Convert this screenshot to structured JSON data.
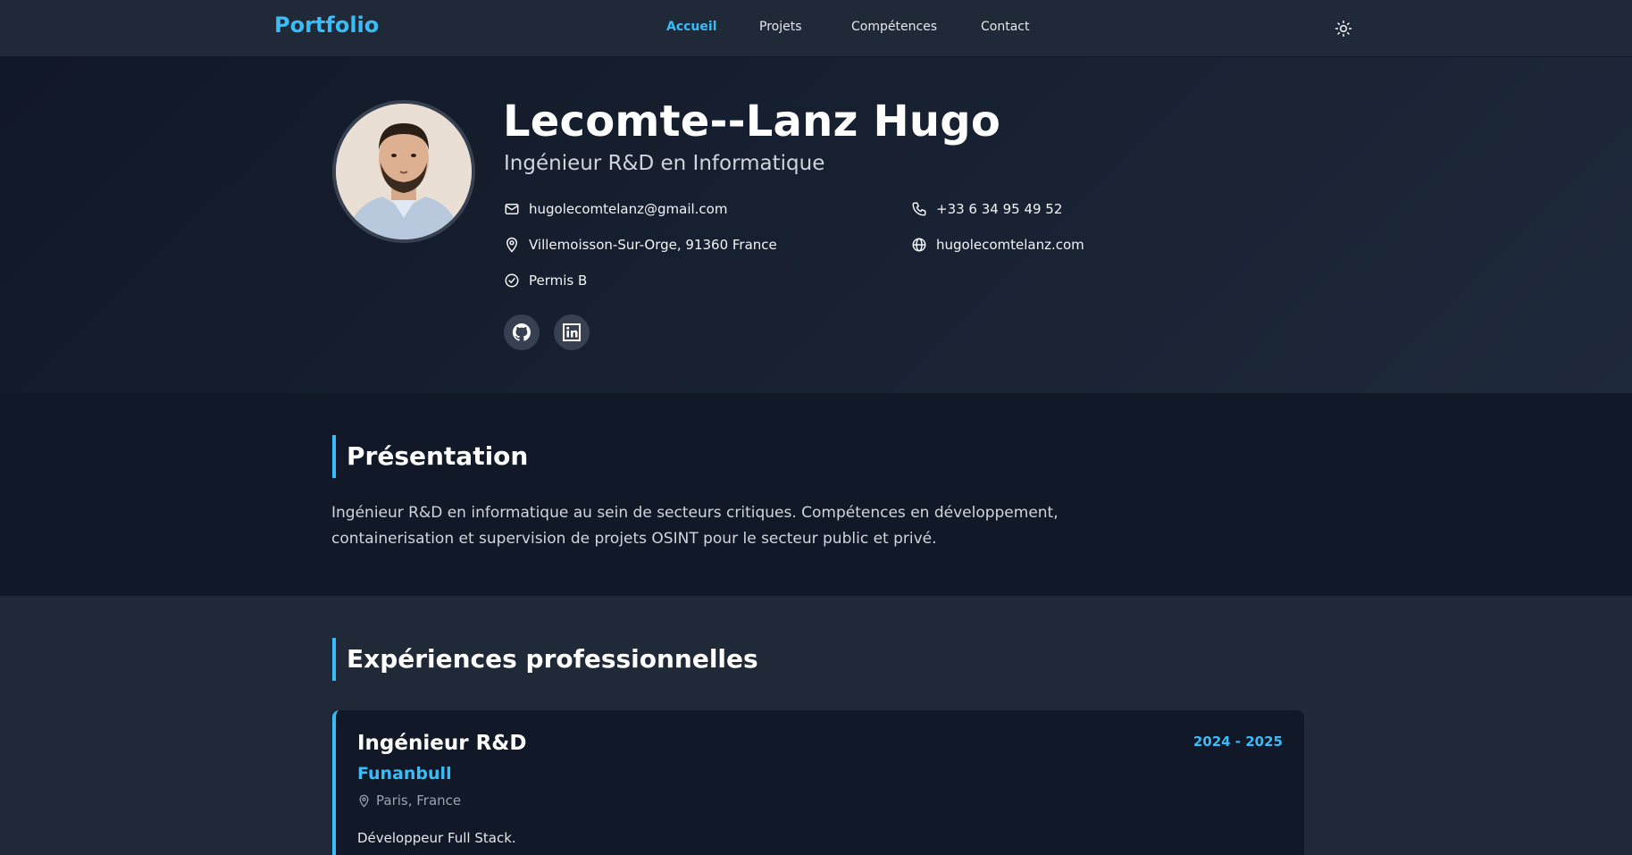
{
  "nav": {
    "brand": "Portfolio",
    "links": [
      {
        "label": "Accueil",
        "active": true
      },
      {
        "label": "Projets",
        "active": false
      },
      {
        "label": "Compétences",
        "active": false
      },
      {
        "label": "Contact",
        "active": false
      }
    ],
    "theme_icon": "sun-icon"
  },
  "hero": {
    "name": "Lecomte--Lanz Hugo",
    "subtitle": "Ingénieur R&D en Informatique",
    "email": "hugolecomtelanz@gmail.com",
    "phone": "+33 6 34 95 49 52",
    "location": "Villemoisson-Sur-Orge, 91360 France",
    "website": "hugolecomtelanz.com",
    "license": "Permis B",
    "socials": [
      {
        "icon": "github-icon"
      },
      {
        "icon": "linkedin-icon"
      }
    ]
  },
  "presentation": {
    "title": "Présentation",
    "text": "Ingénieur R&D en informatique au sein de secteurs critiques. Compétences en développement, containerisation et supervision de projets OSINT pour le secteur public et privé."
  },
  "experiences": {
    "title": "Expériences professionnelles",
    "items": [
      {
        "role": "Ingénieur R&D",
        "company": "Funanbull",
        "location": "Paris, France",
        "dates": "2024 - 2025",
        "description": "Développeur Full Stack."
      }
    ]
  },
  "colors": {
    "accent": "#38bdf8",
    "background": "#1f2937",
    "background_dark": "#111827"
  }
}
